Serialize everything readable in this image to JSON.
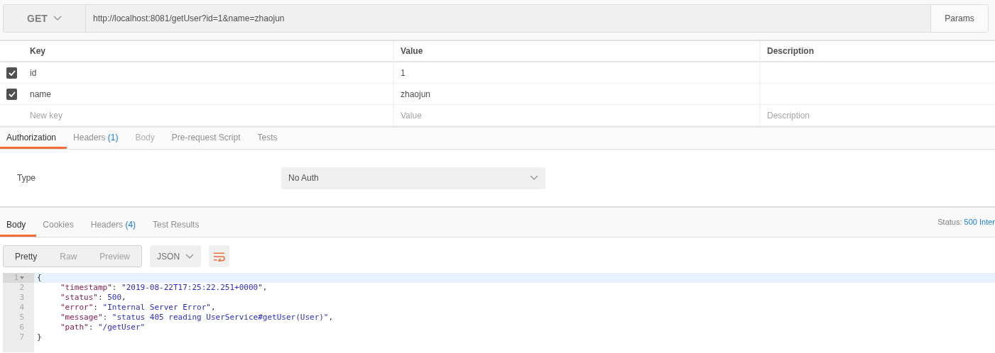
{
  "request": {
    "method": "GET",
    "url": "http://localhost:8081/getUser?id=1&name=zhaojun",
    "params_button": "Params"
  },
  "params": {
    "columns": [
      "Key",
      "Value",
      "Description"
    ],
    "rows": [
      {
        "checked": true,
        "key": "id",
        "value": "1"
      },
      {
        "checked": true,
        "key": "name",
        "value": "zhaojun"
      }
    ],
    "new_row": {
      "key_placeholder": "New key",
      "value_placeholder": "Value",
      "description_placeholder": "Description"
    }
  },
  "request_tabs": [
    {
      "label": "Authorization",
      "selected": true,
      "disabled": false
    },
    {
      "label": "Headers",
      "count": "(1)",
      "selected": false,
      "disabled": false
    },
    {
      "label": "Body",
      "selected": false,
      "disabled": true
    },
    {
      "label": "Pre-request Script",
      "selected": false,
      "disabled": false
    },
    {
      "label": "Tests",
      "selected": false,
      "disabled": false
    }
  ],
  "auth": {
    "label": "Type",
    "value": "No Auth"
  },
  "response_tabs": [
    {
      "label": "Body",
      "selected": true
    },
    {
      "label": "Cookies",
      "selected": false
    },
    {
      "label": "Headers",
      "count": "(4)",
      "selected": false
    },
    {
      "label": "Test Results",
      "selected": false
    }
  ],
  "status": {
    "label": "Status:",
    "value": "500 Inter"
  },
  "view_modes": [
    {
      "label": "Pretty",
      "selected": true
    },
    {
      "label": "Raw",
      "selected": false
    },
    {
      "label": "Preview",
      "selected": false
    }
  ],
  "format": "JSON",
  "code": [
    {
      "number": "1",
      "active": true,
      "foldable": true,
      "tokens": [
        {
          "kind": "punct",
          "text": "{"
        }
      ],
      "children": [
        {
          "number": "2",
          "active": false,
          "tokens": [
            {
              "kind": "key",
              "text": "\"timestamp\""
            },
            {
              "kind": "punct",
              "text": ": "
            },
            {
              "kind": "string",
              "text": "\"2019-08-22T17:25:22.251+0000\""
            },
            {
              "kind": "punct",
              "text": ","
            }
          ]
        },
        {
          "number": "3",
          "active": false,
          "tokens": [
            {
              "kind": "key",
              "text": "\"status\""
            },
            {
              "kind": "punct",
              "text": ": "
            },
            {
              "kind": "number",
              "text": "500"
            },
            {
              "kind": "punct",
              "text": ","
            }
          ]
        },
        {
          "number": "4",
          "active": false,
          "tokens": [
            {
              "kind": "key",
              "text": "\"error\""
            },
            {
              "kind": "punct",
              "text": ": "
            },
            {
              "kind": "string",
              "text": "\"Internal Server Error\""
            },
            {
              "kind": "punct",
              "text": ","
            }
          ]
        },
        {
          "number": "5",
          "active": false,
          "tokens": [
            {
              "kind": "key",
              "text": "\"message\""
            },
            {
              "kind": "punct",
              "text": ": "
            },
            {
              "kind": "string",
              "text": "\"status 405 reading UserService#getUser(User)\""
            },
            {
              "kind": "punct",
              "text": ","
            }
          ]
        },
        {
          "number": "6",
          "active": false,
          "tokens": [
            {
              "kind": "key",
              "text": "\"path\""
            },
            {
              "kind": "punct",
              "text": ": "
            },
            {
              "kind": "string",
              "text": "\"/getUser\""
            }
          ]
        }
      ]
    },
    {
      "number": "7",
      "active": false,
      "tokens": [
        {
          "kind": "punct",
          "text": "}"
        }
      ]
    }
  ]
}
